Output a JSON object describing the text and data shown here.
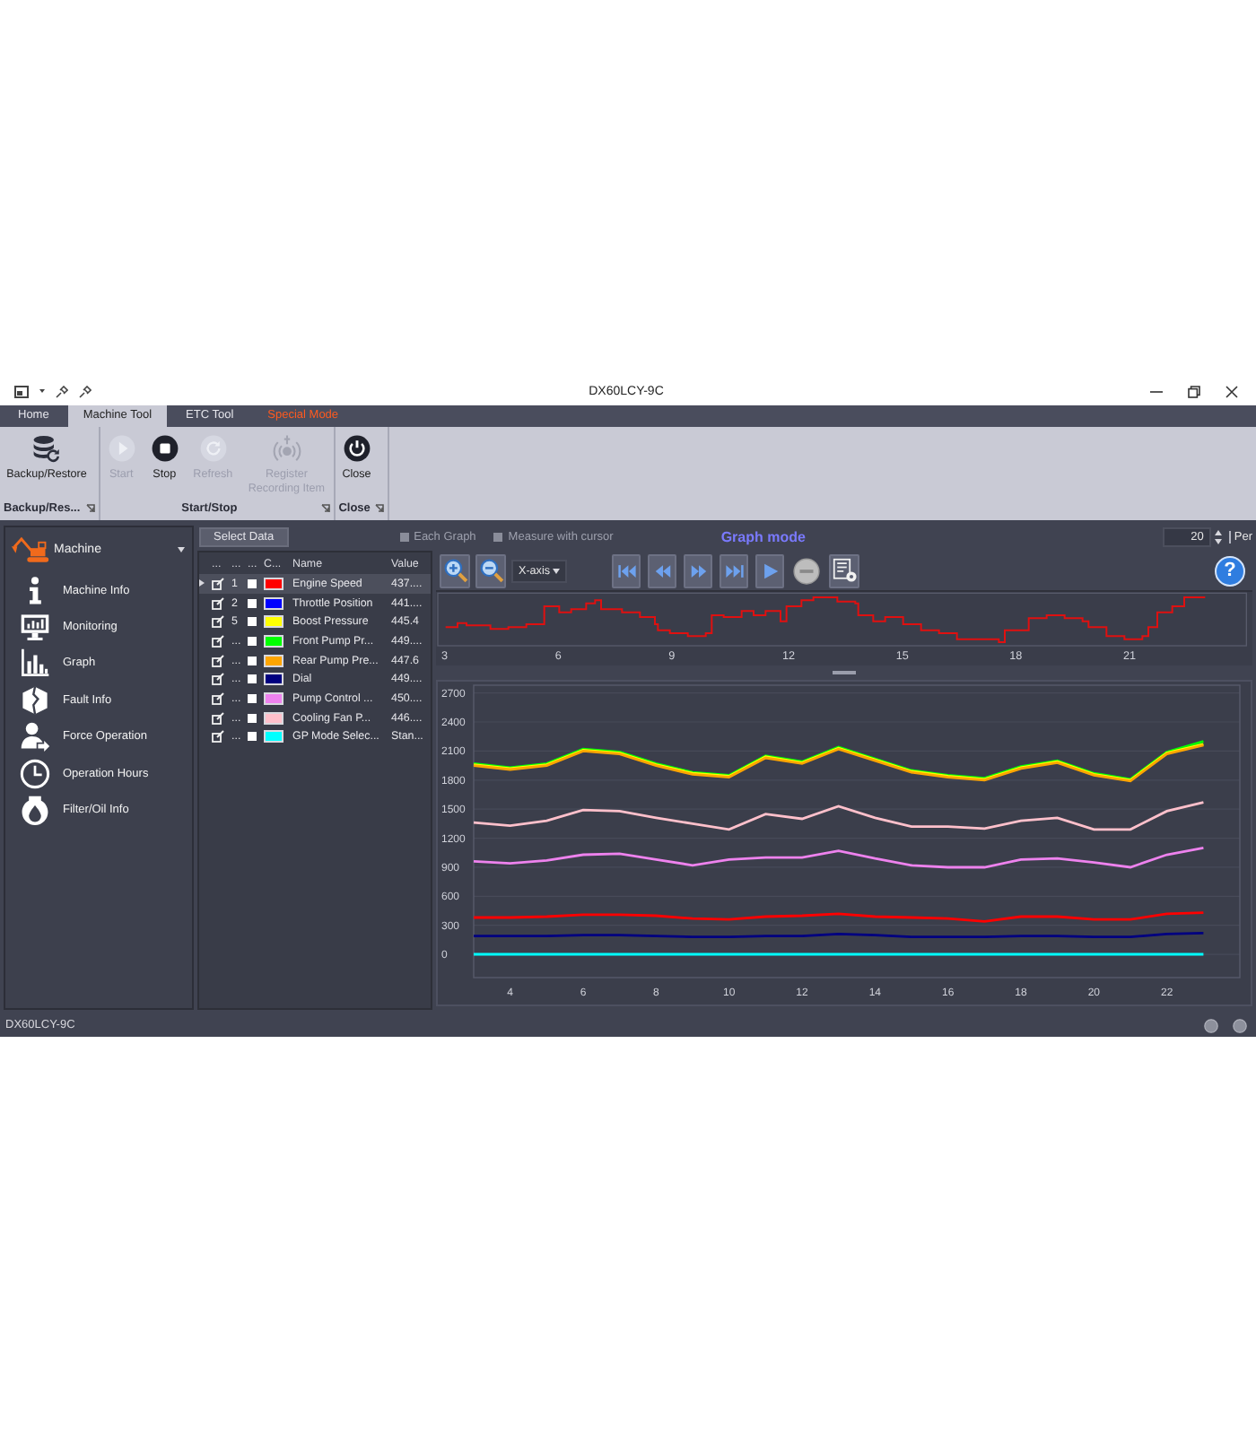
{
  "window": {
    "title": "DX60LCY-9C"
  },
  "tabs": [
    {
      "label": "Home",
      "selected": false,
      "kind": "normal"
    },
    {
      "label": "Machine Tool",
      "selected": true,
      "kind": "normal"
    },
    {
      "label": "ETC Tool",
      "selected": false,
      "kind": "normal"
    },
    {
      "label": "Special Mode",
      "selected": false,
      "kind": "special"
    }
  ],
  "ribbon": {
    "groups": [
      {
        "label": "Backup/Res...",
        "buttons": [
          {
            "label": "Backup/Restore",
            "kind": "database",
            "disabled": false
          }
        ]
      },
      {
        "label": "Start/Stop",
        "buttons": [
          {
            "label": "Start",
            "kind": "play",
            "disabled": true
          },
          {
            "label": "Stop",
            "kind": "stop",
            "disabled": false
          },
          {
            "label": "Refresh",
            "kind": "refresh",
            "disabled": true
          },
          {
            "label": "Register Recording Item",
            "kind": "register",
            "disabled": true
          }
        ]
      },
      {
        "label": "Close",
        "buttons": [
          {
            "label": "Close",
            "kind": "power",
            "disabled": false
          }
        ]
      }
    ]
  },
  "sidebar": {
    "header": "Machine",
    "items": [
      {
        "label": "Machine Info",
        "kind": "info"
      },
      {
        "label": "Monitoring",
        "kind": "monitor"
      },
      {
        "label": "Graph",
        "kind": "graph"
      },
      {
        "label": "Fault Info",
        "kind": "fault"
      },
      {
        "label": "Force Operation",
        "kind": "force"
      },
      {
        "label": "Operation Hours",
        "kind": "clock"
      },
      {
        "label": "Filter/Oil Info",
        "kind": "filter"
      }
    ]
  },
  "data_panel": {
    "button": "Select Data",
    "columns": [
      "...",
      "...",
      "...",
      "C...",
      "Name",
      "Value"
    ],
    "rows": [
      {
        "selected": true,
        "number": "1",
        "checked": false,
        "color": "#ff0000",
        "name": "Engine Speed",
        "value": "437...."
      },
      {
        "selected": false,
        "number": "2",
        "checked": false,
        "color": "#0000ff",
        "name": "Throttle Position",
        "value": "441...."
      },
      {
        "selected": false,
        "number": "5",
        "checked": false,
        "color": "#ffff00",
        "name": "Boost Pressure",
        "value": "445.4"
      },
      {
        "selected": false,
        "number": "...",
        "checked": false,
        "color": "#00ff00",
        "name": "Front Pump Pr...",
        "value": "449...."
      },
      {
        "selected": false,
        "number": "...",
        "checked": false,
        "color": "#ffa500",
        "name": "Rear Pump Pre...",
        "value": "447.6"
      },
      {
        "selected": false,
        "number": "...",
        "checked": false,
        "color": "#000080",
        "name": "Dial",
        "value": "449...."
      },
      {
        "selected": false,
        "number": "...",
        "checked": false,
        "color": "#ee82ee",
        "name": "Pump Control ...",
        "value": "450...."
      },
      {
        "selected": false,
        "number": "...",
        "checked": false,
        "color": "#ffc0cb",
        "name": "Cooling Fan P...",
        "value": "446...."
      },
      {
        "selected": false,
        "number": "...",
        "checked": false,
        "color": "#00ffff",
        "name": "GP Mode Selec...",
        "value": "Stan..."
      }
    ]
  },
  "graph": {
    "options": [
      {
        "label": "Each Graph",
        "checked": false
      },
      {
        "label": "Measure with cursor",
        "checked": false
      }
    ],
    "mode_label": "Graph mode",
    "spinner_value": "20",
    "unit_label": "Per",
    "axis_select": "X-axis",
    "help": "?",
    "overview": {
      "x_labels": [
        "3",
        "6",
        "9",
        "12",
        "15",
        "18",
        "21"
      ]
    },
    "chart_data": {
      "type": "line",
      "grid": true,
      "x": [
        3,
        4,
        5,
        6,
        7,
        8,
        9,
        10,
        11,
        12,
        13,
        14,
        15,
        16,
        17,
        18,
        19,
        20,
        21,
        22,
        23
      ],
      "xlim": [
        3,
        24
      ],
      "ylim": [
        -240,
        2780
      ],
      "xticks": [
        4,
        6,
        8,
        10,
        12,
        14,
        16,
        18,
        20,
        22
      ],
      "yticks": [
        0,
        300,
        600,
        900,
        1200,
        1500,
        1800,
        2100,
        2400,
        2700
      ],
      "series": [
        {
          "color": "#00ff00",
          "values": [
            1970,
            1930,
            1970,
            2120,
            2090,
            1970,
            1880,
            1850,
            2050,
            1990,
            2140,
            2020,
            1900,
            1850,
            1820,
            1940,
            2000,
            1870,
            1810,
            2090,
            2200
          ]
        },
        {
          "color": "#ffff00",
          "values": [
            1960,
            1920,
            1960,
            2110,
            2080,
            1960,
            1870,
            1840,
            2040,
            1980,
            2130,
            2010,
            1890,
            1840,
            1810,
            1930,
            1990,
            1860,
            1800,
            2080,
            2170
          ]
        },
        {
          "color": "#ffa500",
          "values": [
            1950,
            1910,
            1950,
            2100,
            2070,
            1950,
            1860,
            1830,
            2030,
            1970,
            2120,
            2000,
            1880,
            1830,
            1800,
            1920,
            1980,
            1850,
            1790,
            2070,
            2160
          ]
        },
        {
          "color": "#ffc0cb",
          "values": [
            1360,
            1330,
            1380,
            1490,
            1480,
            1410,
            1350,
            1290,
            1450,
            1400,
            1530,
            1410,
            1320,
            1320,
            1300,
            1380,
            1410,
            1290,
            1290,
            1480,
            1570
          ]
        },
        {
          "color": "#ee82ee",
          "values": [
            960,
            940,
            970,
            1030,
            1040,
            980,
            920,
            980,
            1000,
            1000,
            1070,
            990,
            920,
            900,
            900,
            980,
            990,
            950,
            900,
            1030,
            1100
          ]
        },
        {
          "color": "#ff0000",
          "values": [
            380,
            380,
            390,
            410,
            410,
            400,
            370,
            360,
            390,
            400,
            420,
            390,
            380,
            370,
            340,
            390,
            390,
            360,
            360,
            420,
            430
          ]
        },
        {
          "color": "#000080",
          "values": [
            190,
            190,
            190,
            200,
            200,
            190,
            180,
            180,
            190,
            190,
            210,
            200,
            180,
            180,
            180,
            190,
            190,
            180,
            180,
            210,
            220
          ]
        },
        {
          "color": "#00ffff",
          "values": [
            0,
            0,
            0,
            0,
            0,
            0,
            0,
            0,
            0,
            0,
            0,
            0,
            0,
            0,
            0,
            0,
            0,
            0,
            0,
            0,
            0
          ]
        }
      ]
    }
  },
  "status_bar": {
    "text": "DX60LCY-9C"
  }
}
